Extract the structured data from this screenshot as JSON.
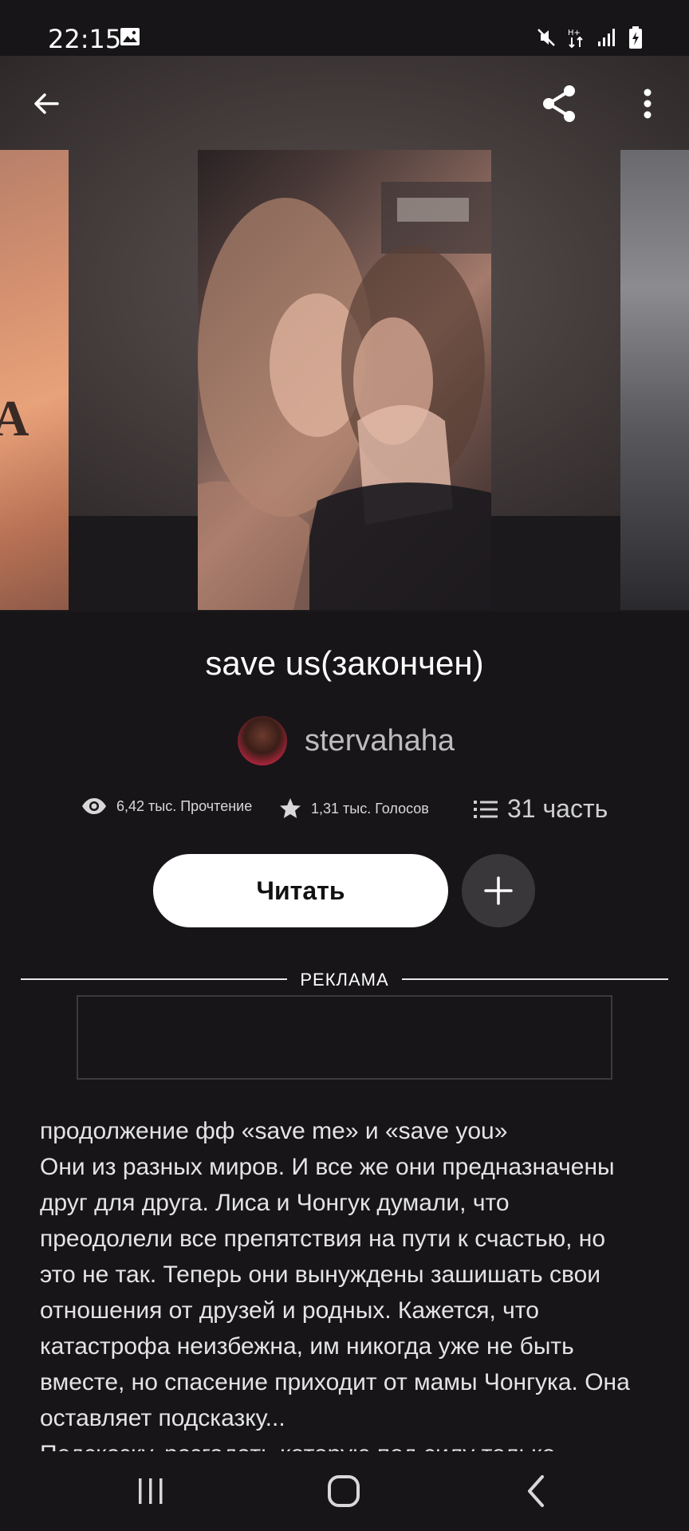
{
  "status_bar": {
    "time": "22:15",
    "icons": [
      "image-icon",
      "mute-icon",
      "data-transfer-icon",
      "signal-icon",
      "battery-charging-icon"
    ]
  },
  "toolbar": {
    "back_icon": "arrow-left-icon",
    "share_icon": "share-icon",
    "more_icon": "more-vertical-icon"
  },
  "covers": {
    "left_text": "DA"
  },
  "story": {
    "title": "save us(закончен)",
    "author": "stervahaha",
    "stats": {
      "reads": "6,42 тыс. Прочтение",
      "votes": "1,31 тыс. Голосов",
      "parts": "31 часть"
    },
    "read_button": "Читать",
    "add_icon": "plus-icon"
  },
  "ad": {
    "label": "РЕКЛАМА"
  },
  "description": "продолжение фф «save me» и «save you»\nОни из разных миров. И все же они предназначены друг для друга. Лиса и Чонгук думали, что преодолели все препятствия на пути к счастью, но это не так. Теперь они вынуждены зашишать свои отношения от друзей и родных. Кажется, что катастрофа неизбежна, им никогда уже не быть вместе, но спасение приходит от мамы Чонгука. Она оставляет подсказку...\nПодсказку, разгадать которую под силу только",
  "nav_bar": {
    "recents_icon": "recents-icon",
    "home_icon": "home-icon",
    "back_icon": "nav-back-icon"
  },
  "colors": {
    "background": "#171518",
    "read_button_bg": "#ffffff",
    "add_button_bg": "#39373a",
    "author_text": "#bdbdbd"
  }
}
